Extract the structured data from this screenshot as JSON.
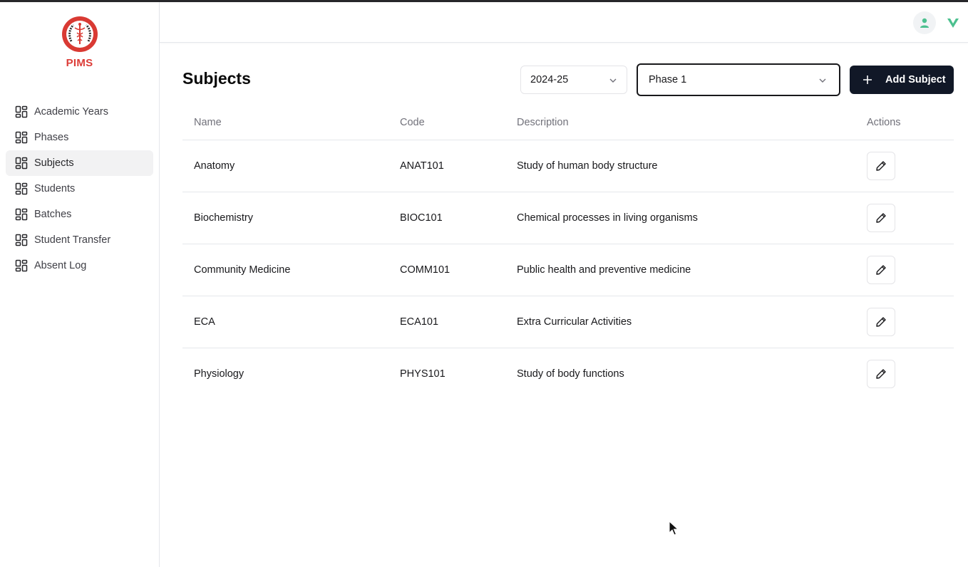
{
  "brand": {
    "name": "PIMS"
  },
  "sidebar": {
    "items": [
      {
        "label": "Academic Years",
        "active": false
      },
      {
        "label": "Phases",
        "active": false
      },
      {
        "label": "Subjects",
        "active": true
      },
      {
        "label": "Students",
        "active": false
      },
      {
        "label": "Batches",
        "active": false
      },
      {
        "label": "Student Transfer",
        "active": false
      },
      {
        "label": "Absent Log",
        "active": false
      }
    ]
  },
  "header": {
    "icons": [
      "user-icon",
      "v-logo-icon"
    ]
  },
  "main": {
    "title": "Subjects",
    "year_select": {
      "value": "2024-25"
    },
    "phase_select": {
      "value": "Phase 1"
    },
    "add_button": {
      "label": "Add Subject"
    },
    "table": {
      "columns": {
        "name": "Name",
        "code": "Code",
        "description": "Description",
        "actions": "Actions"
      },
      "rows": [
        {
          "name": "Anatomy",
          "code": "ANAT101",
          "description": "Study of human body structure"
        },
        {
          "name": "Biochemistry",
          "code": "BIOC101",
          "description": "Chemical processes in living organisms"
        },
        {
          "name": "Community Medicine",
          "code": "COMM101",
          "description": "Public health and preventive medicine"
        },
        {
          "name": "ECA",
          "code": "ECA101",
          "description": "Extra Curricular Activities"
        },
        {
          "name": "Physiology",
          "code": "PHYS101",
          "description": "Study of body functions"
        }
      ]
    }
  },
  "colors": {
    "brand_red": "#dc3c37",
    "primary_dark": "#111827",
    "accent_green": "#4cc08f"
  }
}
